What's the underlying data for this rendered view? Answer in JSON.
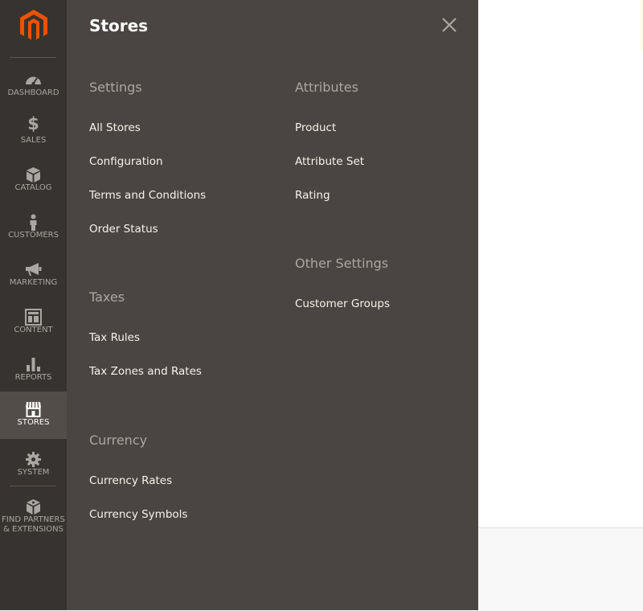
{
  "nav": {
    "items": [
      {
        "label": "DASHBOARD",
        "icon": "dashboard-icon"
      },
      {
        "label": "SALES",
        "icon": "dollar-icon"
      },
      {
        "label": "CATALOG",
        "icon": "box-icon"
      },
      {
        "label": "CUSTOMERS",
        "icon": "person-icon"
      },
      {
        "label": "MARKETING",
        "icon": "megaphone-icon"
      },
      {
        "label": "CONTENT",
        "icon": "layout-icon"
      },
      {
        "label": "REPORTS",
        "icon": "bar-chart-icon"
      },
      {
        "label": "STORES",
        "icon": "storefront-icon",
        "active": true
      },
      {
        "label": "SYSTEM",
        "icon": "gear-icon"
      },
      {
        "label": "FIND PARTNERS",
        "label2": "& EXTENSIONS",
        "icon": "package-icon"
      }
    ]
  },
  "panel": {
    "title": "Stores",
    "sections": {
      "settings": {
        "title": "Settings",
        "links": [
          "All Stores",
          "Configuration",
          "Terms and Conditions",
          "Order Status"
        ]
      },
      "taxes": {
        "title": "Taxes",
        "links": [
          "Tax Rules",
          "Tax Zones and Rates"
        ]
      },
      "currency": {
        "title": "Currency",
        "links": [
          "Currency Rates",
          "Currency Symbols"
        ]
      },
      "attributes": {
        "title": "Attributes",
        "links": [
          "Product",
          "Attribute Set",
          "Rating"
        ]
      },
      "other_settings": {
        "title": "Other Settings",
        "links": [
          "Customer Groups"
        ]
      }
    }
  },
  "colors": {
    "nav_bg": "#373330",
    "panel_bg": "#4a4542",
    "active_bg": "#524d49",
    "brand_orange": "#eb5202"
  }
}
